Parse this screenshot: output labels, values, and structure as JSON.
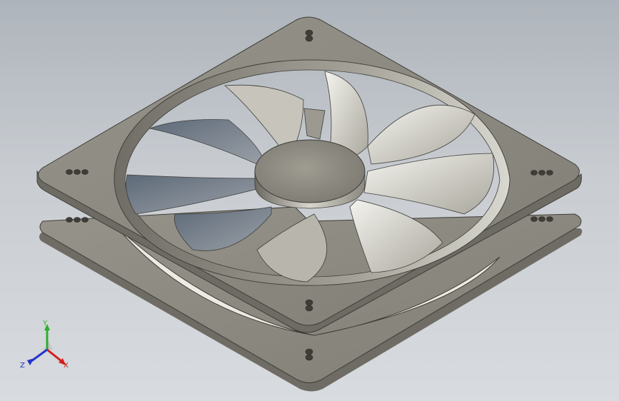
{
  "viewport": {
    "model": "axial-fan-assembly",
    "background_top": "#aeb4bb",
    "background_bottom": "#d8dbdf",
    "body_color": "#8c8a80"
  },
  "triad": {
    "x_label": "X",
    "y_label": "Y",
    "z_label": "Z",
    "x_color": "#d21e1e",
    "y_color": "#2eae2e",
    "z_color": "#2233cc"
  }
}
